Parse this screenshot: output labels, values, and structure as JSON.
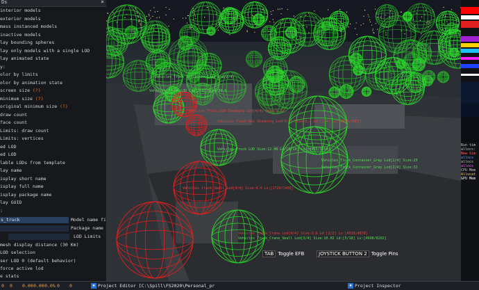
{
  "panel": {
    "title": "Ds",
    "rows": [
      {
        "text": "interior models"
      },
      {
        "text": "exterior models"
      },
      {
        "text": "mass instanced models"
      },
      {
        "text": "inactive models"
      },
      {
        "text": "lay bounding spheres"
      },
      {
        "text": "lay only models with a single LOD"
      },
      {
        "text": "lay animated state"
      },
      {
        "text": "y:"
      },
      {
        "text": "olor by limits"
      },
      {
        "text": "olor by animation state"
      },
      {
        "text": "screen size",
        "q": "(?)"
      },
      {
        "text": "minimum size",
        "q": "(?)"
      },
      {
        "text": "original minimum size",
        "q": "(?)"
      },
      {
        "text": "draw count"
      },
      {
        "text": "face count"
      },
      {
        "text": "Limits: draw count"
      },
      {
        "text": "Limits: vertices"
      },
      {
        "text": "ed LOD"
      },
      {
        "text": "ed LOD"
      },
      {
        "text": "lable LODs from template"
      },
      {
        "text": "lay name"
      },
      {
        "text": "isplay short name"
      },
      {
        "text": "isplay full name"
      },
      {
        "text": "isplay package name"
      },
      {
        "text": "lay GUID"
      },
      {
        "text": ":"
      }
    ],
    "filter_value": "s_truck",
    "filter_label": "Model name fil",
    "package_label": "Package name f",
    "lod_limits_label": "LOD Limits",
    "rows2": [
      {
        "text": "mesh display distance (30 Km)"
      },
      {
        "text": "LOD selection"
      },
      {
        "text": "ser LOD 0 (default behavior)"
      },
      {
        "text": "force active lod"
      },
      {
        "text": "e stats"
      }
    ],
    "footer": [
      "0",
      "0",
      "0.00",
      "0.00",
      "0.0%",
      "0",
      "0"
    ]
  },
  "scene": {
    "labels_green": [
      "Vehicles_Truck_Container_Gray Lod[2/4]",
      "Vehicles_Truck_LOD Lod[2/4] Size:29.5",
      "Vehicles_Truck_Container_Gray Lod[2/4] Size:29",
      "Vehicles_Truck_Container_Gray Lod[2/4] Size:32",
      "Vehicles Truck LOD Size:12.49 Ld:[5/18] Lv:[3965/3659]",
      "Vehicles_Truck_Crane_Small Lod[3/4] Size:10.02 Ld:[5/18] Lv:[4698/8202]"
    ],
    "labels_red": [
      "Vehicles_Truck_LOD Shadeing Lod[4/4] Size:5.32",
      "Vehicles_Truck_Bus_Shadeing Lod[4/4] Size:6.2 Ld:[2/4] Lv:[1555/2052]",
      "Vehicles_truck_Small Lod[4/4] Size:4.4 Lv:[1720/1408]",
      "Vehicles_Truck_Crane Lod[4/4] Size:3.8 Ld:[2/2] Lv:[4930/4878]"
    ],
    "hint1_key": "TAB",
    "hint1_text": "Toggle EFB",
    "hint2_key": "JOYSTICK BUTTON 2",
    "hint2_text": "Toggle Pins"
  },
  "rside": {
    "labels": [
      "Run tim",
      "allocs:",
      "New Sim",
      "allocs",
      "allocs",
      "allocs",
      "CPU Mem",
      "Allocat",
      "GPU Mem"
    ]
  },
  "taskbar": {
    "project_editor": "Project Editor [C:\\Spill\\FS2020\\Personal_pr",
    "project_inspector": "Project Inspector"
  }
}
